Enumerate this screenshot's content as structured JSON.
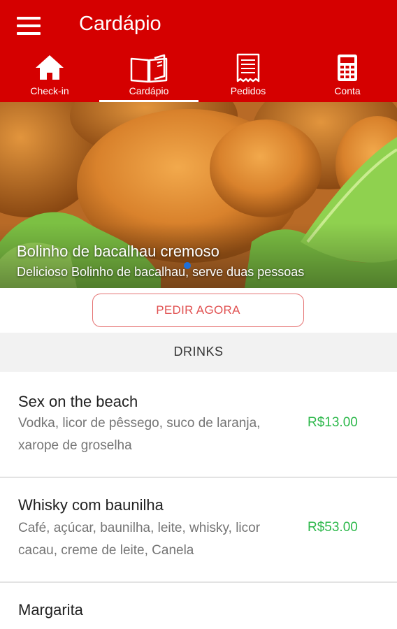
{
  "app_bar": {
    "title": "Cardápio",
    "color": "#d50000",
    "menu_icon": "hamburger-menu-icon"
  },
  "tabs": [
    {
      "label": "Check-in",
      "icon": "home-icon",
      "active": false
    },
    {
      "label": "Cardápio",
      "icon": "open-book-icon",
      "active": true
    },
    {
      "label": "Pedidos",
      "icon": "receipt-icon",
      "active": false
    },
    {
      "label": "Conta",
      "icon": "calculator-icon",
      "active": false
    }
  ],
  "featured": {
    "title": "Bolinho de bacalhau cremoso",
    "subtitle": "Delicioso Bolinho de bacalhau, serve duas pessoas",
    "image": "fried-codfish-balls-photo",
    "order_button": "PEDIR AGORA"
  },
  "section": {
    "title": "DRINKS"
  },
  "items": [
    {
      "name": "Sex on the beach",
      "description": "Vodka, licor de pêssego, suco de laranja, xarope de groselha",
      "price": "R$13.00"
    },
    {
      "name": "Whisky com baunilha",
      "description": "Café, açúcar, baunilha, leite, whisky, licor cacau, creme de leite, Canela",
      "price": "R$53.00"
    },
    {
      "name": "Margarita",
      "description": "",
      "price": ""
    }
  ],
  "colors": {
    "accent": "#d50000",
    "price": "#2db84b",
    "order_button_text": "#e15252"
  }
}
